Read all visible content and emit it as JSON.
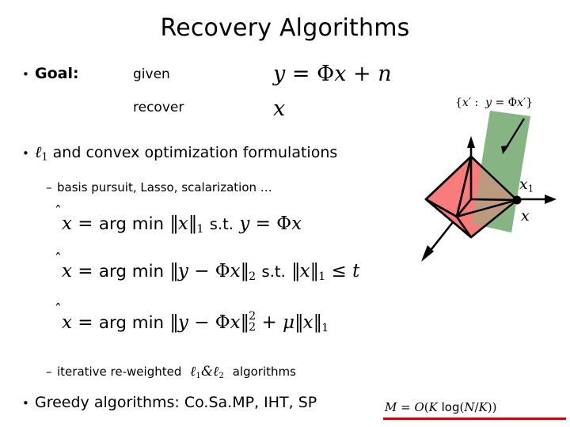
{
  "slide": {
    "title": "Recovery Algorithms",
    "background_color": "#ffffff",
    "text_color": "#000000"
  },
  "bullets": {
    "goal": {
      "marker": "•",
      "label": "Goal:",
      "given_word": "given",
      "recover_word": "recover",
      "given_equation": "y = Φx + n",
      "recover_equation": "x"
    },
    "l1_convex": {
      "marker": "•",
      "ell": "ℓ",
      "ell_sub": "1",
      "text": " and convex optimization formulations"
    },
    "sub_basis": {
      "marker": "–",
      "text": "basis pursuit, Lasso, scalarization …"
    },
    "sub_iterative": {
      "marker": "–",
      "text_before": "iterative re-weighted",
      "math": "ℓ1&ℓ2",
      "text_after": "algorithms"
    },
    "greedy": {
      "marker": "•",
      "text": "Greedy algorithms: Co.Sa.MP, IHT, SP"
    }
  },
  "equations": {
    "eq1": {
      "lhs": "x̂",
      "eq": "=",
      "argmin": "arg min",
      "objective": "‖x‖₁",
      "st": "s.t.",
      "constraint": "y = Φx"
    },
    "eq2": {
      "lhs": "x̂",
      "eq": "=",
      "argmin": "arg min",
      "objective": "‖y − Φx‖₂",
      "st": "s.t.",
      "constraint": "‖x‖₁ ≤ t"
    },
    "eq3": {
      "lhs": "x̂",
      "eq": "=",
      "argmin": "arg min",
      "objective": "‖y − Φx‖₂² + μ‖x‖₁"
    },
    "measurement_bound": {
      "text": "M = O(K log(N/K))",
      "underline_color": "#e00000"
    }
  },
  "diagram": {
    "name": "l1-ball-hyperplane-geometry",
    "hyperplane_label": "{x′ :  y = Φx′}",
    "point_label_upper": "x₁",
    "point_label_lower": "x",
    "l1_ball_fill": "#fa7b7b",
    "l1_ball_edge": "#000000",
    "hyperplane_fill": "#86b583",
    "axis_color": "#000000"
  }
}
